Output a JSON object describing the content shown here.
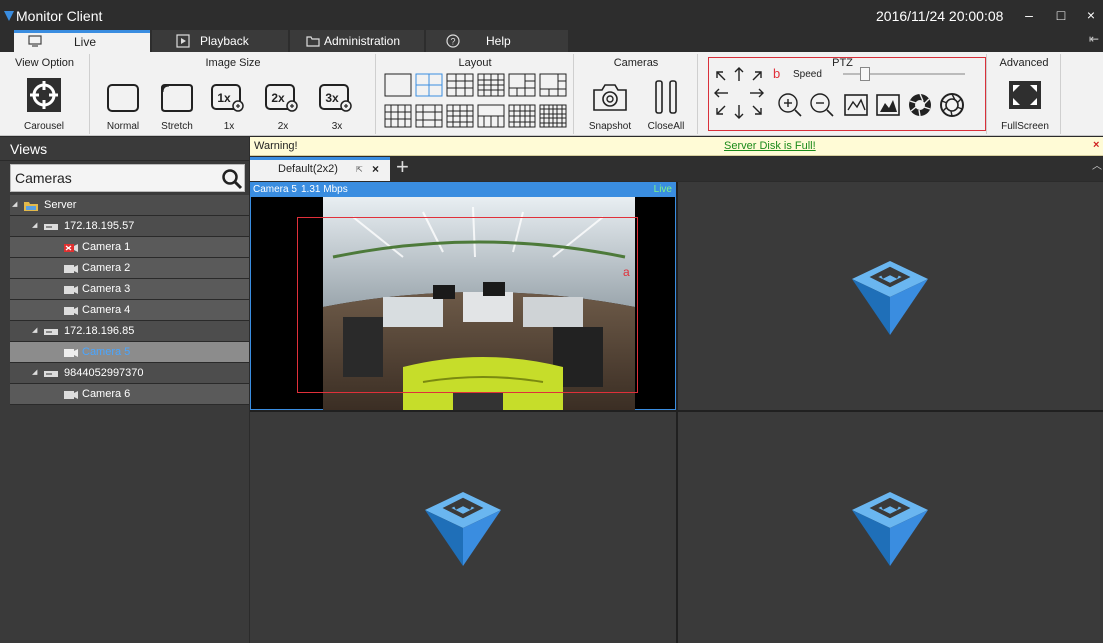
{
  "window": {
    "title": "Monitor Client",
    "datetime": "2016/11/24 20:00:08",
    "controls": {
      "minimize": "–",
      "maximize": "□",
      "close": "×"
    }
  },
  "main_tabs": [
    {
      "label": "Live",
      "icon": "monitor-icon",
      "active": true
    },
    {
      "label": "Playback",
      "icon": "play-icon"
    },
    {
      "label": "Administration",
      "icon": "folder-icon"
    },
    {
      "label": "Help",
      "icon": "question-icon"
    }
  ],
  "ribbon": {
    "view_option": {
      "title": "View Option",
      "carousel": "Carousel"
    },
    "image_size": {
      "title": "Image Size",
      "normal": "Normal",
      "stretch": "Stretch",
      "x1": "1x",
      "x2": "2x",
      "x3": "3x",
      "x1_glyph": "1x",
      "x2_glyph": "2x",
      "x3_glyph": "3x"
    },
    "layout": {
      "title": "Layout"
    },
    "cameras": {
      "title": "Cameras",
      "snapshot": "Snapshot",
      "close_all": "CloseAll"
    },
    "ptz": {
      "title": "PTZ",
      "speed": "Speed",
      "marker": "b",
      "speed_level": 0.15
    },
    "advanced": {
      "title": "Advanced",
      "fullscreen": "FullScreen"
    }
  },
  "left_panel": {
    "views_title": "Views",
    "cameras_search": "Cameras",
    "tree": [
      {
        "label": "Server",
        "level": 0,
        "icon": "folder-icon"
      },
      {
        "label": "172.18.195.57",
        "level": 1,
        "icon": "recorder-icon"
      },
      {
        "label": "Camera 1",
        "level": 2,
        "icon": "camera-error-icon"
      },
      {
        "label": "Camera 2",
        "level": 2,
        "icon": "camera-icon"
      },
      {
        "label": "Camera 3",
        "level": 2,
        "icon": "camera-icon"
      },
      {
        "label": "Camera 4",
        "level": 2,
        "icon": "camera-icon"
      },
      {
        "label": "172.18.196.85",
        "level": 1,
        "icon": "recorder-icon"
      },
      {
        "label": "Camera 5",
        "level": 2,
        "icon": "camera-icon",
        "selected": true
      },
      {
        "label": "9844052997370",
        "level": 1,
        "icon": "recorder-icon"
      },
      {
        "label": "Camera 6",
        "level": 2,
        "icon": "camera-icon"
      }
    ]
  },
  "warning": {
    "label": "Warning!",
    "message": "Server Disk is Full!",
    "close": "×"
  },
  "view_tabs": [
    {
      "label": "Default(2x2)",
      "active": true,
      "close": "×"
    }
  ],
  "view_tab_add": "+",
  "cells": [
    {
      "camera": "Camera 5",
      "bitrate": "1.31 Mbps",
      "status": "Live",
      "roi_label": "a"
    },
    {
      "placeholder": "logo"
    },
    {
      "placeholder": "logo"
    },
    {
      "placeholder": "logo"
    }
  ],
  "colors": {
    "accent": "#3a8de0",
    "warning_bg": "#fffbd6",
    "highlight_red": "#e0303a",
    "panel_dark": "#3a3a3a"
  }
}
